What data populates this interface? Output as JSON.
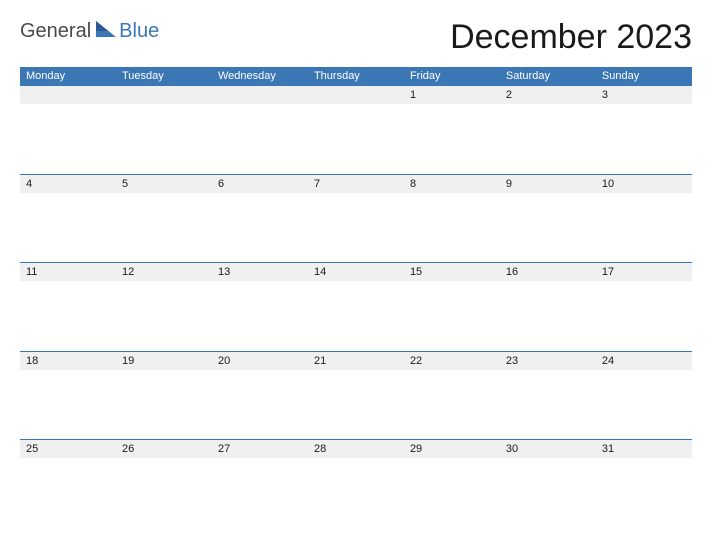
{
  "brand": {
    "part1": "General",
    "part2": "Blue"
  },
  "title": "December 2023",
  "day_headers": [
    "Monday",
    "Tuesday",
    "Wednesday",
    "Thursday",
    "Friday",
    "Saturday",
    "Sunday"
  ],
  "weeks": [
    [
      "",
      "",
      "",
      "",
      "1",
      "2",
      "3"
    ],
    [
      "4",
      "5",
      "6",
      "7",
      "8",
      "9",
      "10"
    ],
    [
      "11",
      "12",
      "13",
      "14",
      "15",
      "16",
      "17"
    ],
    [
      "18",
      "19",
      "20",
      "21",
      "22",
      "23",
      "24"
    ],
    [
      "25",
      "26",
      "27",
      "28",
      "29",
      "30",
      "31"
    ]
  ],
  "colors": {
    "accent": "#3b76b5",
    "muted_bg": "#f0f0f0"
  }
}
